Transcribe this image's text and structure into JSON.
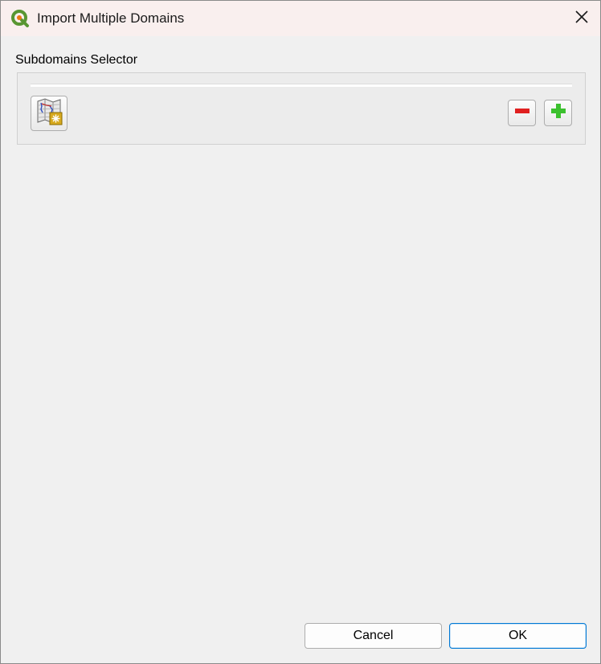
{
  "window": {
    "title": "Import Multiple Domains"
  },
  "icons": {
    "app": "qgis-logo-icon",
    "close": "close-icon",
    "map": "map-grid-icon",
    "remove": "minus-icon",
    "add": "plus-icon"
  },
  "selector": {
    "label": "Subdomains Selector"
  },
  "footer": {
    "cancel_label": "Cancel",
    "ok_label": "OK"
  },
  "colors": {
    "remove": "#e02020",
    "add": "#3cc12f",
    "accent": "#0078d4"
  }
}
